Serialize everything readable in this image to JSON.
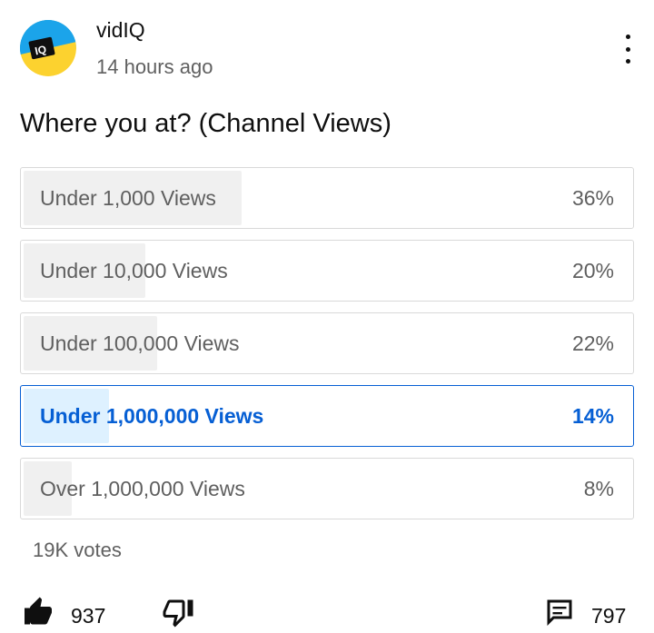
{
  "post": {
    "channel_name": "vidIQ",
    "timestamp": "14 hours ago",
    "avatar_text": "IQ",
    "question": "Where you at? (Channel Views)"
  },
  "poll": {
    "options": [
      {
        "label": "Under 1,000 Views",
        "percent_text": "36%",
        "percent": 36,
        "selected": false
      },
      {
        "label": "Under 10,000 Views",
        "percent_text": "20%",
        "percent": 20,
        "selected": false
      },
      {
        "label": "Under 100,000 Views",
        "percent_text": "22%",
        "percent": 22,
        "selected": false
      },
      {
        "label": "Under 1,000,000 Views",
        "percent_text": "14%",
        "percent": 14,
        "selected": true
      },
      {
        "label": "Over 1,000,000 Views",
        "percent_text": "8%",
        "percent": 8,
        "selected": false
      }
    ],
    "votes": "19K votes"
  },
  "actions": {
    "likes": "937",
    "comments": "797"
  },
  "icons": {
    "avatar": "vidiq-logo-icon",
    "more": "more-vertical-icon",
    "like": "thumbs-up-icon",
    "dislike": "thumbs-down-icon",
    "comment": "comment-icon"
  },
  "colors": {
    "accent": "#065fd4",
    "selected_fill": "#def1ff",
    "option_fill": "#f0f0f0",
    "avatar_blue": "#1ba4ea",
    "avatar_yellow": "#fcd22f"
  }
}
